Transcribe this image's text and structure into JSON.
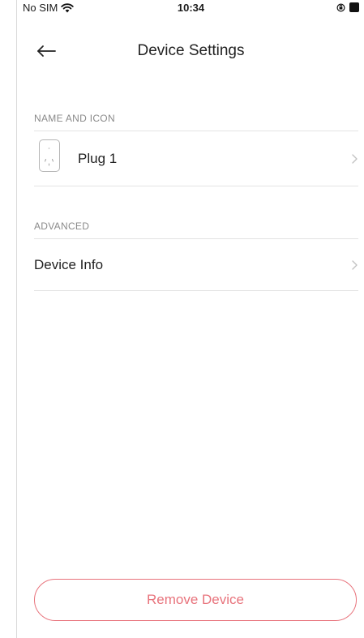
{
  "status_bar": {
    "carrier": "No SIM",
    "time": "10:34"
  },
  "nav": {
    "title": "Device Settings"
  },
  "sections": {
    "name_icon": {
      "header": "NAME AND ICON",
      "device_name": "Plug 1"
    },
    "advanced": {
      "header": "ADVANCED",
      "device_info_label": "Device Info"
    }
  },
  "remove_button": {
    "label": "Remove Device"
  },
  "colors": {
    "accent_remove": "#e8737c",
    "section_header": "#8a8a8a",
    "divider": "#e3e3e3"
  },
  "icons": [
    "wifi-icon",
    "orientation-lock-icon",
    "battery-icon",
    "back-arrow-icon",
    "plug-icon",
    "chevron-right-icon"
  ]
}
